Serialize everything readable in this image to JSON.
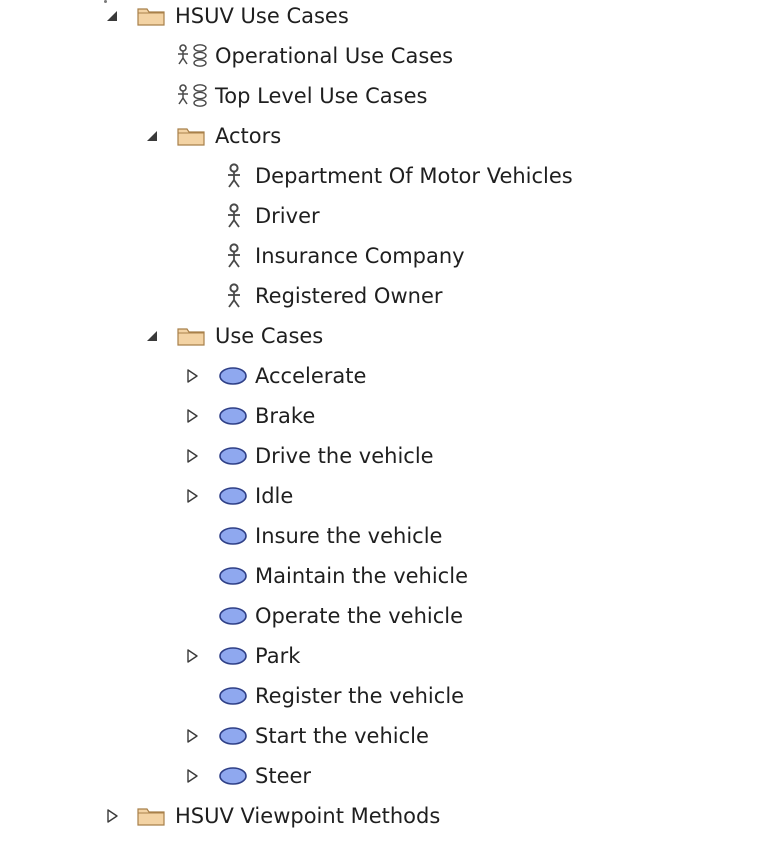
{
  "tree": [
    {
      "label": "HSUV Use Cases",
      "type": "folder",
      "level": 0,
      "state": "expanded"
    },
    {
      "label": "Operational Use Cases",
      "type": "usecase-diagram",
      "level": 1,
      "state": "leaf"
    },
    {
      "label": "Top Level Use Cases",
      "type": "usecase-diagram",
      "level": 1,
      "state": "leaf"
    },
    {
      "label": "Actors",
      "type": "folder",
      "level": 1,
      "state": "expanded"
    },
    {
      "label": "Department Of Motor Vehicles",
      "type": "actor",
      "level": 2,
      "state": "leaf"
    },
    {
      "label": "Driver",
      "type": "actor",
      "level": 2,
      "state": "leaf"
    },
    {
      "label": "Insurance Company",
      "type": "actor",
      "level": 2,
      "state": "leaf"
    },
    {
      "label": "Registered Owner",
      "type": "actor",
      "level": 2,
      "state": "leaf"
    },
    {
      "label": "Use Cases",
      "type": "folder",
      "level": 1,
      "state": "expanded"
    },
    {
      "label": "Accelerate",
      "type": "usecase",
      "level": 2,
      "state": "collapsed"
    },
    {
      "label": "Brake",
      "type": "usecase",
      "level": 2,
      "state": "collapsed"
    },
    {
      "label": "Drive the vehicle",
      "type": "usecase",
      "level": 2,
      "state": "collapsed"
    },
    {
      "label": "Idle",
      "type": "usecase",
      "level": 2,
      "state": "collapsed"
    },
    {
      "label": "Insure the vehicle",
      "type": "usecase",
      "level": 2,
      "state": "leaf"
    },
    {
      "label": "Maintain the vehicle",
      "type": "usecase",
      "level": 2,
      "state": "leaf"
    },
    {
      "label": "Operate the vehicle",
      "type": "usecase",
      "level": 2,
      "state": "leaf"
    },
    {
      "label": "Park",
      "type": "usecase",
      "level": 2,
      "state": "collapsed"
    },
    {
      "label": "Register the vehicle",
      "type": "usecase",
      "level": 2,
      "state": "leaf"
    },
    {
      "label": "Start the vehicle",
      "type": "usecase",
      "level": 2,
      "state": "collapsed"
    },
    {
      "label": "Steer",
      "type": "usecase",
      "level": 2,
      "state": "collapsed"
    },
    {
      "label": "HSUV Viewpoint Methods",
      "type": "folder",
      "level": 0,
      "state": "collapsed"
    }
  ],
  "colors": {
    "folder_fill": "#f3d3a4",
    "folder_stroke": "#a8804a",
    "usecase_fill": "#8fa8ef",
    "usecase_stroke": "#2e3f86",
    "actor": "#4a4a4a",
    "expander": "#3a3a3a",
    "text": "#1f1f1f"
  }
}
